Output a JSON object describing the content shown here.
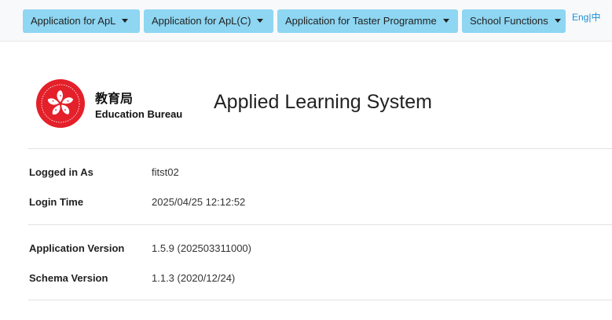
{
  "navbar": {
    "menus": [
      {
        "label": "Application for ApL"
      },
      {
        "label": "Application for ApL(C)"
      },
      {
        "label": "Application for Taster Programme"
      },
      {
        "label": "School Functions"
      }
    ],
    "language": {
      "english": "Eng",
      "separator": "|",
      "chinese": "中"
    }
  },
  "header": {
    "org_name_zh": "教育局",
    "org_name_en": "Education Bureau",
    "system_title": "Applied Learning System"
  },
  "session": {
    "logged_in_as_label": "Logged in As",
    "logged_in_as_value": "fitst02",
    "login_time_label": "Login Time",
    "login_time_value": "2025/04/25 12:12:52"
  },
  "version": {
    "application_version_label": "Application Version",
    "application_version_value": "1.5.9 (202503311000)",
    "schema_version_label": "Schema Version",
    "schema_version_value": "1.1.3 (2020/12/24)"
  },
  "colors": {
    "menu_button_bg": "#8ed6f2",
    "link_blue": "#1a8fd6",
    "logo_red": "#e4202a"
  }
}
